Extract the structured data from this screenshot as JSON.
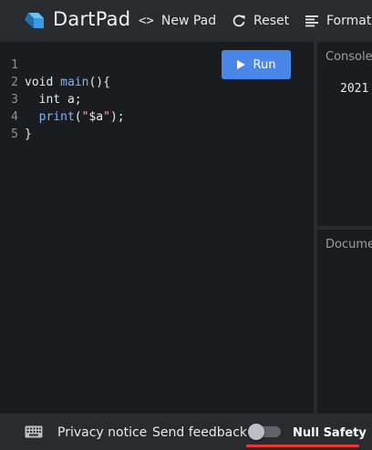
{
  "header": {
    "brand": "DartPad",
    "new_pad_label": "New Pad",
    "reset_label": "Reset",
    "format_label": "Format",
    "icons": {
      "new_pad": "code-brackets-icon",
      "reset": "refresh-icon",
      "format": "format-align-icon"
    }
  },
  "editor": {
    "run_label": "Run",
    "lines": [
      {
        "num": "1"
      },
      {
        "num": "2",
        "a": "void ",
        "fn": "main",
        "b": "(){"
      },
      {
        "num": "3",
        "a": "  int a;"
      },
      {
        "num": "4",
        "a": "  ",
        "fn": "print",
        "b": "(",
        "str1": "\"",
        "interp": "$a",
        "str2": "\"",
        "c": ");"
      },
      {
        "num": "5",
        "a": "}"
      }
    ]
  },
  "console": {
    "title": "Console",
    "output": "2021"
  },
  "docs": {
    "title": "Documentation"
  },
  "footer": {
    "privacy_label": "Privacy notice",
    "feedback_label": "Send feedback",
    "null_safety_label": "Null Safety",
    "null_safety_enabled": false
  },
  "colors": {
    "accent": "#4a86e8",
    "highlight": "#e53935",
    "background": "#1e1f23"
  }
}
